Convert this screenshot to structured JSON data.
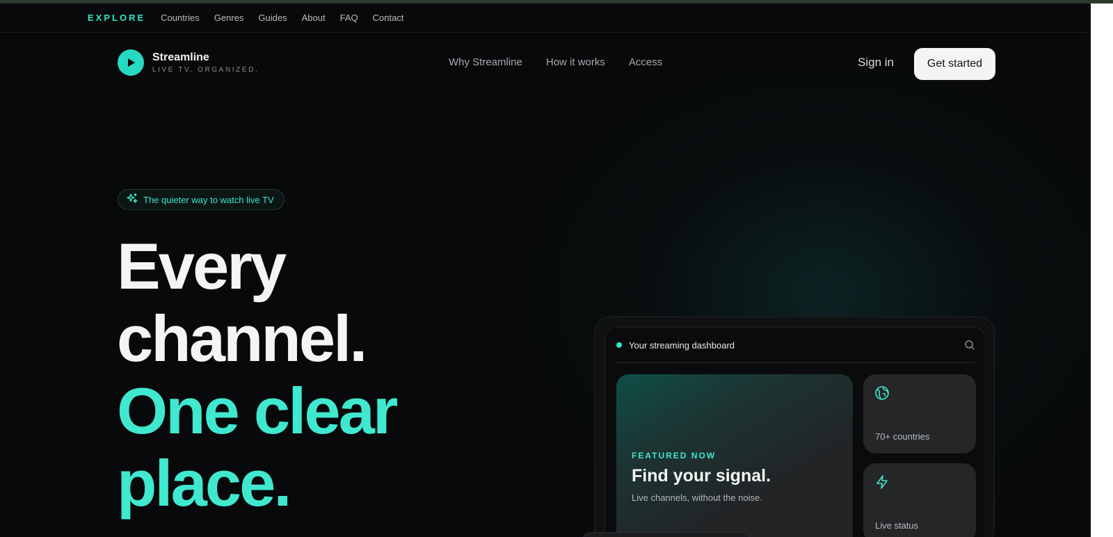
{
  "explore": {
    "label": "EXPLORE",
    "links": [
      "Countries",
      "Genres",
      "Guides",
      "About",
      "FAQ",
      "Contact"
    ]
  },
  "brand": {
    "name": "Streamline",
    "tagline": "LIVE TV, ORGANIZED."
  },
  "nav": {
    "links": [
      "Why Streamline",
      "How it works",
      "Access"
    ],
    "sign_in": "Sign in",
    "cta": "Get started"
  },
  "hero": {
    "badge": "The quieter way to watch live TV",
    "lines_white": [
      "Every",
      "channel."
    ],
    "lines_teal": [
      "One clear",
      "place."
    ]
  },
  "dashboard": {
    "title": "Your streaming dashboard",
    "featured": {
      "kicker": "FEATURED NOW",
      "title": "Find your signal.",
      "subtitle": "Live channels, without the noise."
    },
    "stat1": "70+ countries",
    "stat2": "Live status"
  },
  "colors": {
    "accent": "#2ee6c8",
    "background": "#08090a",
    "card": "#242628"
  }
}
